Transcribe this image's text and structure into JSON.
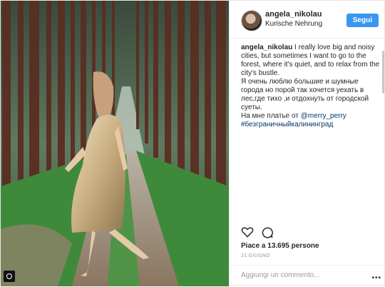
{
  "post": {
    "username": "angela_nikolau",
    "location": "Kurische Nehrung",
    "follow_label": "Segui",
    "caption": {
      "username": "angela_nikolau",
      "text_en": "I really love big and noisy cities, but sometimes I want to go to the forest, where it's quiet, and to relax from the city's bustle.",
      "text_ru": "Я очень люблю большие и шумные города но порой так хочется уехать в лес,где тихо ,и отдохнуть от городской суеты.",
      "dress_prefix": "На мне платье от",
      "mention": "@merry_perry",
      "hashtag": "#безграничныйкалининград"
    },
    "likes": "Piace a 13.695 persone",
    "date": "21 GIUGNO",
    "comment_placeholder": "Aggiungi un commento...",
    "more_label": "•••"
  },
  "icons": [
    "heart-icon",
    "comment-icon",
    "more-icon",
    "corner-badge-icon"
  ],
  "colors": {
    "follow": "#3897f0",
    "link": "#003569",
    "text": "#262626",
    "muted": "#999999"
  }
}
